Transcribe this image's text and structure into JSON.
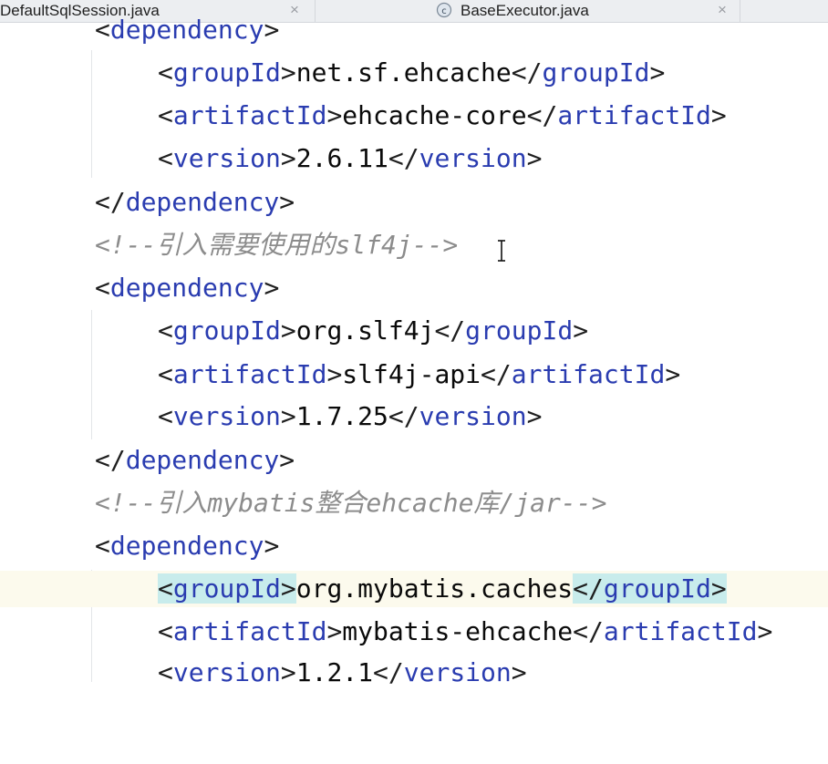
{
  "tabs": [
    {
      "title": "DefaultSqlSession.java",
      "close": "×"
    },
    {
      "title": "BaseExecutor.java",
      "close": "×",
      "icon": "java-class-icon"
    }
  ],
  "code": {
    "lines": [
      {
        "open": "<",
        "tag": "dependency",
        "close": ">"
      },
      {
        "open": "<",
        "tag": "groupId",
        "mid": ">",
        "text": "net.sf.ehcache",
        "open2": "</",
        "tag2": "groupId",
        "close": ">"
      },
      {
        "open": "<",
        "tag": "artifactId",
        "mid": ">",
        "text": "ehcache-core",
        "open2": "</",
        "tag2": "artifactId",
        "close": ">"
      },
      {
        "open": "<",
        "tag": "version",
        "mid": ">",
        "text": "2.6.11",
        "open2": "</",
        "tag2": "version",
        "close": ">"
      },
      {
        "open": "</",
        "tag": "dependency",
        "close": ">"
      },
      {
        "comment": "<!--引入需要使用的slf4j-->"
      },
      {
        "open": "<",
        "tag": "dependency",
        "close": ">"
      },
      {
        "open": "<",
        "tag": "groupId",
        "mid": ">",
        "text": "org.slf4j",
        "open2": "</",
        "tag2": "groupId",
        "close": ">"
      },
      {
        "open": "<",
        "tag": "artifactId",
        "mid": ">",
        "text": "slf4j-api",
        "open2": "</",
        "tag2": "artifactId",
        "close": ">"
      },
      {
        "open": "<",
        "tag": "version",
        "mid": ">",
        "text": "1.7.25",
        "open2": "</",
        "tag2": "version",
        "close": ">"
      },
      {
        "open": "</",
        "tag": "dependency",
        "close": ">"
      },
      {
        "comment": "<!--引入mybatis整合ehcache库/jar-->"
      },
      {
        "open": "<",
        "tag": "dependency",
        "close": ">"
      },
      {
        "open": "<",
        "tag": "groupId",
        "mid": ">",
        "text": "org.mybatis.caches",
        "open2": "</",
        "tag2": "groupId",
        "close": ">"
      },
      {
        "open": "<",
        "tag": "artifactId",
        "mid": ">",
        "text": "mybatis-ehcache",
        "open2": "</",
        "tag2": "artifactId",
        "close": ">"
      },
      {
        "open": "<",
        "tag": "version",
        "mid": ">",
        "text": "1.2.1",
        "open2": "</",
        "tag2": "version",
        "close": ">"
      }
    ]
  },
  "colors": {
    "tag": "#2a3cb0",
    "comment": "#8c8c8c",
    "text": "#0a0a0a",
    "current_line": "#fcfaed",
    "tag_match_highlight": "#c8ecec"
  }
}
